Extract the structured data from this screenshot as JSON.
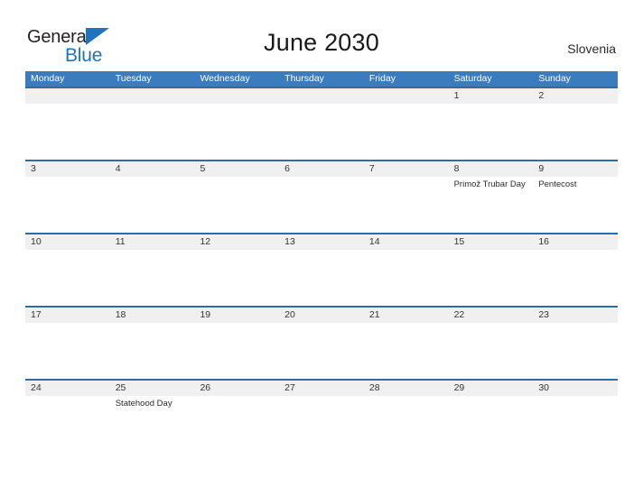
{
  "brand": {
    "line1": "General",
    "line2": "Blue",
    "flag_icon": "triangle-flag-icon",
    "accent_color": "#1f74bb"
  },
  "header": {
    "title": "June 2030",
    "country": "Slovenia"
  },
  "colors": {
    "header_blue": "#3a7cbe",
    "row_divider_blue": "#2d6ca6",
    "band_gray": "#f0f0f0"
  },
  "calendar": {
    "weekday_headers": [
      "Monday",
      "Tuesday",
      "Wednesday",
      "Thursday",
      "Friday",
      "Saturday",
      "Sunday"
    ],
    "weeks": [
      {
        "days": [
          {
            "num": "",
            "event": ""
          },
          {
            "num": "",
            "event": ""
          },
          {
            "num": "",
            "event": ""
          },
          {
            "num": "",
            "event": ""
          },
          {
            "num": "",
            "event": ""
          },
          {
            "num": "1",
            "event": ""
          },
          {
            "num": "2",
            "event": ""
          }
        ]
      },
      {
        "days": [
          {
            "num": "3",
            "event": ""
          },
          {
            "num": "4",
            "event": ""
          },
          {
            "num": "5",
            "event": ""
          },
          {
            "num": "6",
            "event": ""
          },
          {
            "num": "7",
            "event": ""
          },
          {
            "num": "8",
            "event": "Primož Trubar Day"
          },
          {
            "num": "9",
            "event": "Pentecost"
          }
        ]
      },
      {
        "days": [
          {
            "num": "10",
            "event": ""
          },
          {
            "num": "11",
            "event": ""
          },
          {
            "num": "12",
            "event": ""
          },
          {
            "num": "13",
            "event": ""
          },
          {
            "num": "14",
            "event": ""
          },
          {
            "num": "15",
            "event": ""
          },
          {
            "num": "16",
            "event": ""
          }
        ]
      },
      {
        "days": [
          {
            "num": "17",
            "event": ""
          },
          {
            "num": "18",
            "event": ""
          },
          {
            "num": "19",
            "event": ""
          },
          {
            "num": "20",
            "event": ""
          },
          {
            "num": "21",
            "event": ""
          },
          {
            "num": "22",
            "event": ""
          },
          {
            "num": "23",
            "event": ""
          }
        ]
      },
      {
        "days": [
          {
            "num": "24",
            "event": ""
          },
          {
            "num": "25",
            "event": "Statehood Day"
          },
          {
            "num": "26",
            "event": ""
          },
          {
            "num": "27",
            "event": ""
          },
          {
            "num": "28",
            "event": ""
          },
          {
            "num": "29",
            "event": ""
          },
          {
            "num": "30",
            "event": ""
          }
        ]
      }
    ]
  }
}
